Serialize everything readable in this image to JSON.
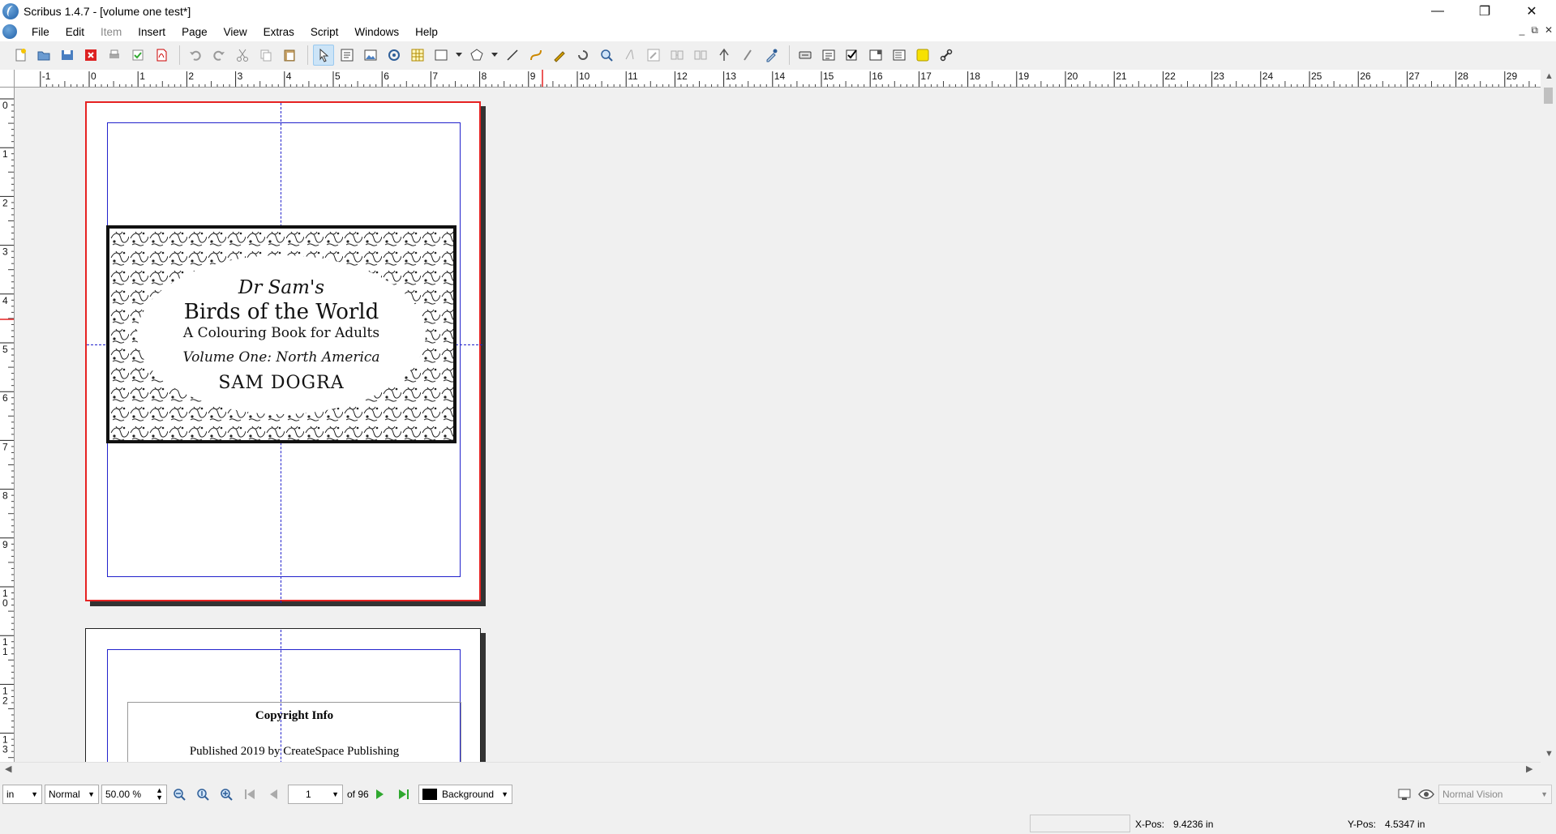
{
  "window": {
    "title": "Scribus 1.4.7 - [volume one test*]",
    "minimize": "—",
    "restore": "❐",
    "close": "✕"
  },
  "menu": {
    "items": [
      "File",
      "Edit",
      "Item",
      "Insert",
      "Page",
      "View",
      "Extras",
      "Script",
      "Windows",
      "Help"
    ],
    "disabled": [
      "Item"
    ]
  },
  "mdi": {
    "minimize": "_",
    "restore": "⧉",
    "close": "✕"
  },
  "ruler": {
    "h_labels": [
      "-1",
      "0",
      "1",
      "2",
      "3",
      "4",
      "5",
      "6",
      "7",
      "8",
      "9",
      "10",
      "11",
      "12",
      "13",
      "14",
      "15",
      "16",
      "17",
      "18",
      "19",
      "20",
      "21",
      "22",
      "23",
      "24",
      "25",
      "26",
      "27",
      "28",
      "29"
    ],
    "v_labels": [
      "0",
      "1",
      "2",
      "3",
      "4",
      "5",
      "6",
      "7",
      "8",
      "9",
      "10",
      "11",
      "12",
      "13"
    ]
  },
  "cover": {
    "line1": "Dr Sam's",
    "line2": "Birds of the World",
    "line3": "A Colouring Book for Adults",
    "line4": "Volume One: North America",
    "line5": "SAM DOGRA"
  },
  "page2": {
    "copyright_title": "Copyright Info",
    "published": "Published 2019 by CreateSpace Publishing"
  },
  "bottom": {
    "unit": "in",
    "mode": "Normal",
    "zoom": "50.00 %",
    "page": "1",
    "of_pages": "of 96",
    "layer": "Background",
    "vision": "Normal Vision"
  },
  "status": {
    "xpos_label": "X-Pos:",
    "xpos_value": "9.4236 in",
    "ypos_label": "Y-Pos:",
    "ypos_value": "4.5347 in"
  },
  "colors": {
    "page_border_selected": "#e62222",
    "margin_guides": "#2222cc",
    "layer_swatch": "#000000",
    "active_tool": "#cce4f7"
  }
}
